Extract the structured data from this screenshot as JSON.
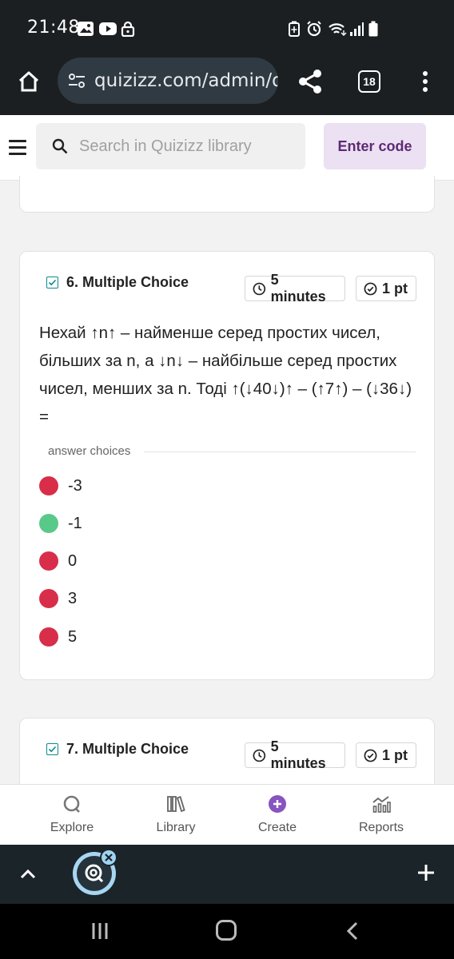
{
  "status_bar": {
    "time": "21:48",
    "left_icons": [
      "image-icon",
      "youtube-icon",
      "lock-icon"
    ],
    "right_icons": [
      "battery-saver-icon",
      "alarm-icon",
      "wifi-icon",
      "signal-icon",
      "battery-icon"
    ]
  },
  "browser": {
    "url": "quizizz.com/admin/quiz",
    "tab_count": "18",
    "icons": [
      "home-icon",
      "site-settings-icon",
      "share-icon",
      "tabs-icon",
      "more-vert-icon"
    ]
  },
  "site_header": {
    "search_placeholder": "Search in Quizizz library",
    "enter_code_label": "Enter code"
  },
  "questions": [
    {
      "title": "6. Multiple Choice",
      "time": "5 minutes",
      "points": "1 pt",
      "text": "Нехай ↑n↑ – найменше серед простих чисел, більших за n, а ↓n↓ – найбільше серед простих чисел, менших за n. Тоді ↑(↓40↓)↑ – (↑7↑) – (↓36↓) =",
      "answer_choices_label": "answer choices",
      "choices": [
        {
          "value": "-3",
          "correct": false
        },
        {
          "value": "-1",
          "correct": true
        },
        {
          "value": "0",
          "correct": false
        },
        {
          "value": "3",
          "correct": false
        },
        {
          "value": "5",
          "correct": false
        }
      ]
    },
    {
      "title": "7. Multiple Choice",
      "time": "5 minutes",
      "points": "1 pt"
    }
  ],
  "app_nav": {
    "items": [
      {
        "label": "Explore",
        "icon": "explore-icon"
      },
      {
        "label": "Library",
        "icon": "library-icon"
      },
      {
        "label": "Create",
        "icon": "create-plus-icon"
      },
      {
        "label": "Reports",
        "icon": "reports-icon"
      }
    ]
  },
  "colors": {
    "wrong": "#d82e4a",
    "correct": "#59c98a",
    "accent_purple": "#8854c0",
    "enter_code_bg": "#ece0f3",
    "enter_code_text": "#5d2a74"
  }
}
